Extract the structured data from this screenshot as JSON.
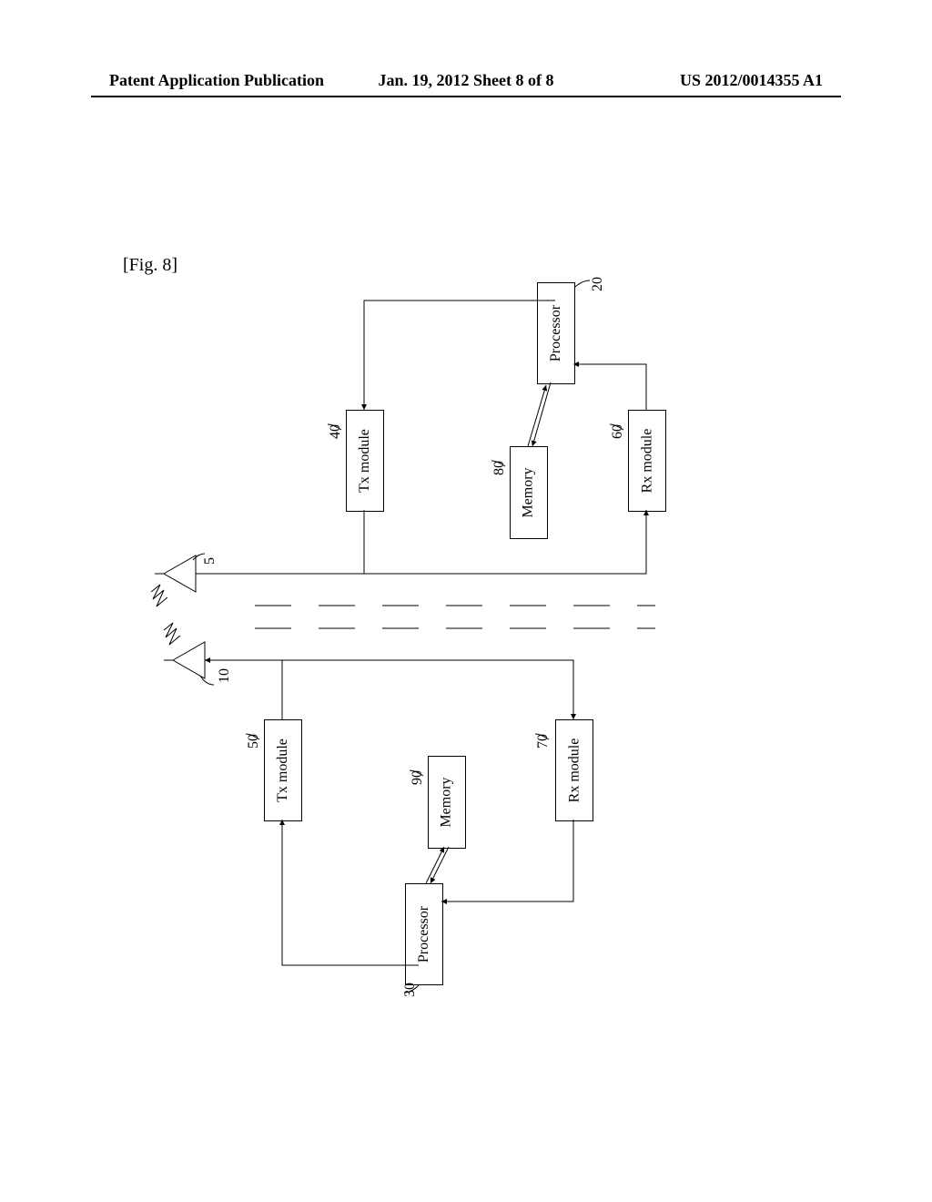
{
  "header": {
    "left": "Patent Application Publication",
    "center": "Jan. 19, 2012  Sheet 8 of 8",
    "right": "US 2012/0014355 A1"
  },
  "figure_label": "[Fig. 8]",
  "blocks": {
    "processor_top": "Processor",
    "processor_bottom": "Processor",
    "tx_top": "Tx module",
    "tx_bottom": "Tx module",
    "memory_top": "Memory",
    "memory_bottom": "Memory",
    "rx_top": "Rx module",
    "rx_bottom": "Rx module"
  },
  "refs": {
    "r5": "5",
    "r10": "10",
    "r20": "20",
    "r30": "30",
    "r40": "40",
    "r50": "50",
    "r60": "60",
    "r70": "70",
    "r80": "80",
    "r90": "90"
  },
  "chart_data": {
    "type": "diagram",
    "title": "Fig. 8",
    "description": "Block diagram of two wireless devices each with Processor, Tx module, Memory, Rx module and antenna",
    "devices": [
      {
        "antenna_ref": 5,
        "processor_ref": 20,
        "tx_ref": 40,
        "rx_ref": 60,
        "memory_ref": 80,
        "blocks": [
          "Processor",
          "Tx module",
          "Memory",
          "Rx module"
        ]
      },
      {
        "antenna_ref": 10,
        "processor_ref": 30,
        "tx_ref": 50,
        "rx_ref": 70,
        "memory_ref": 90,
        "blocks": [
          "Processor",
          "Tx module",
          "Memory",
          "Rx module"
        ]
      }
    ],
    "connections": [
      "Processor <-> Memory (bidirectional)",
      "Processor -> Tx module",
      "Rx module -> Processor",
      "Tx module -> Antenna",
      "Antenna -> Rx module",
      "Device1 antenna <~~> Device2 antenna (wireless)"
    ]
  }
}
